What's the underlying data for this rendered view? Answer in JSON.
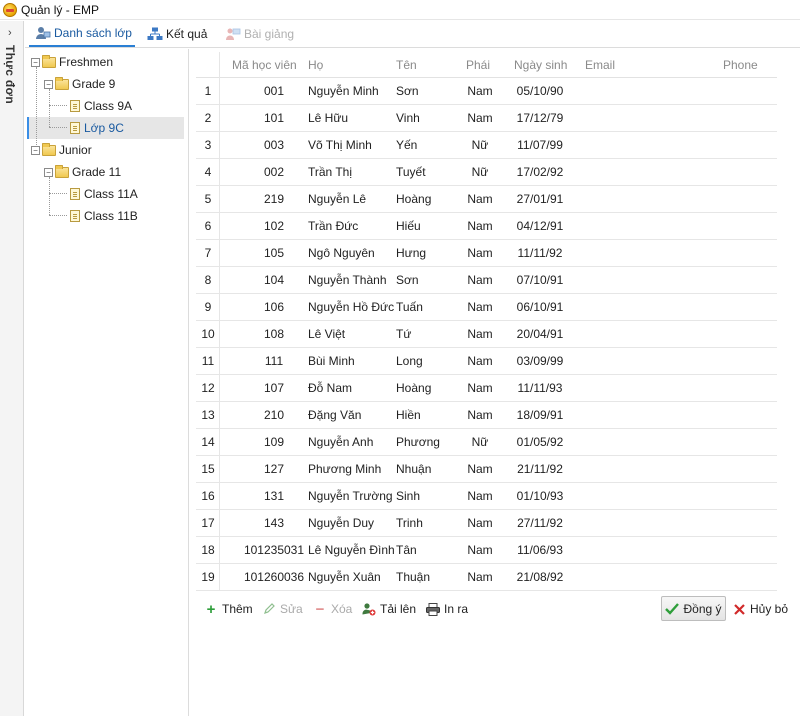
{
  "window": {
    "title": "Quản lý - EMP"
  },
  "sidebar": {
    "label": "Thực đơn",
    "chevron": "›"
  },
  "tabs": [
    {
      "label": "Danh sách lớp",
      "icon": "users-icon",
      "active": true
    },
    {
      "label": "Kết quả",
      "icon": "org-chart-icon",
      "active": false
    },
    {
      "label": "Bài giảng",
      "icon": "lecture-icon",
      "active": false,
      "disabled": true
    }
  ],
  "tree": {
    "nodes": [
      {
        "label": "Freshmen",
        "type": "folder",
        "expander": "−"
      },
      {
        "label": "Grade 9",
        "type": "folder",
        "expander": "−"
      },
      {
        "label": "Class 9A",
        "type": "doc"
      },
      {
        "label": "Lớp 9C",
        "type": "doc",
        "selected": true
      },
      {
        "label": "Junior",
        "type": "folder",
        "expander": "−"
      },
      {
        "label": "Grade 11",
        "type": "folder",
        "expander": "−"
      },
      {
        "label": "Class 11A",
        "type": "doc"
      },
      {
        "label": "Class 11B",
        "type": "doc"
      }
    ]
  },
  "grid": {
    "columns": [
      "Mã học viên",
      "Họ",
      "Tên",
      "Phái",
      "Ngày sinh",
      "Email",
      "Phone"
    ],
    "rows": [
      {
        "n": "1",
        "id": "001",
        "ho": "Nguyễn Minh",
        "ten": "Sơn",
        "phai": "Nam",
        "dob": "05/10/90"
      },
      {
        "n": "2",
        "id": "101",
        "ho": "Lê Hữu",
        "ten": "Vinh",
        "phai": "Nam",
        "dob": "17/12/79"
      },
      {
        "n": "3",
        "id": "003",
        "ho": "Võ Thị Minh",
        "ten": "Yến",
        "phai": "Nữ",
        "dob": "11/07/99"
      },
      {
        "n": "4",
        "id": "002",
        "ho": "Trần Thị",
        "ten": "Tuyết",
        "phai": "Nữ",
        "dob": "17/02/92"
      },
      {
        "n": "5",
        "id": "219",
        "ho": "Nguyễn Lê",
        "ten": "Hoàng",
        "phai": "Nam",
        "dob": "27/01/91"
      },
      {
        "n": "6",
        "id": "102",
        "ho": "Trần Đức",
        "ten": "Hiếu",
        "phai": "Nam",
        "dob": "04/12/91"
      },
      {
        "n": "7",
        "id": "105",
        "ho": "Ngô Nguyên",
        "ten": "Hưng",
        "phai": "Nam",
        "dob": "11/11/92"
      },
      {
        "n": "8",
        "id": "104",
        "ho": "Nguyễn Thành",
        "ten": "Sơn",
        "phai": "Nam",
        "dob": "07/10/91"
      },
      {
        "n": "9",
        "id": "106",
        "ho": "Nguyễn Hồ Đức",
        "ten": "Tuấn",
        "phai": "Nam",
        "dob": "06/10/91"
      },
      {
        "n": "10",
        "id": "108",
        "ho": "Lê Việt",
        "ten": "Tứ",
        "phai": "Nam",
        "dob": "20/04/91"
      },
      {
        "n": "11",
        "id": "111",
        "ho": "Bùi Minh",
        "ten": "Long",
        "phai": "Nam",
        "dob": "03/09/99"
      },
      {
        "n": "12",
        "id": "107",
        "ho": "Đỗ Nam",
        "ten": "Hoàng",
        "phai": "Nam",
        "dob": "11/11/93"
      },
      {
        "n": "13",
        "id": "210",
        "ho": "Đặng Văn",
        "ten": "Hiền",
        "phai": "Nam",
        "dob": "18/09/91"
      },
      {
        "n": "14",
        "id": "109",
        "ho": "Nguyễn Anh",
        "ten": "Phương",
        "phai": "Nữ",
        "dob": "01/05/92"
      },
      {
        "n": "15",
        "id": "127",
        "ho": "Phương Minh",
        "ten": "Nhuận",
        "phai": "Nam",
        "dob": "21/11/92"
      },
      {
        "n": "16",
        "id": "131",
        "ho": "Nguyễn Trường",
        "ten": "Sinh",
        "phai": "Nam",
        "dob": "01/10/93"
      },
      {
        "n": "17",
        "id": "143",
        "ho": "Nguyễn Duy",
        "ten": "Trinh",
        "phai": "Nam",
        "dob": "27/11/92"
      },
      {
        "n": "18",
        "id": "101235031",
        "ho": "Lê Nguyễn Đình",
        "ten": "Tân",
        "phai": "Nam",
        "dob": "11/06/93"
      },
      {
        "n": "19",
        "id": "101260036",
        "ho": "Nguyễn Xuân",
        "ten": "Thuận",
        "phai": "Nam",
        "dob": "21/08/92"
      }
    ]
  },
  "toolbar": {
    "add_label": "Thêm",
    "edit_label": "Sửa",
    "delete_label": "Xóa",
    "upload_label": "Tải lên",
    "print_label": "In ra",
    "ok_label": "Đồng ý",
    "cancel_label": "Hủy bỏ"
  },
  "colors": {
    "accent": "#2a7fd4",
    "add_green": "#2e9e3a",
    "delete_red": "#d9534f",
    "ok_check": "#2e9e3a",
    "cancel_x": "#d12a2a",
    "disabled": "#aaaaaa"
  }
}
